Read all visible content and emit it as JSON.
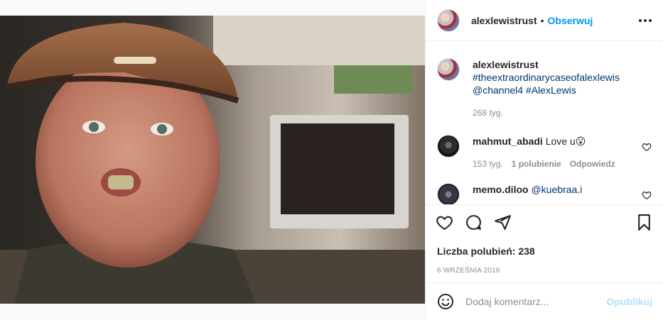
{
  "post": {
    "author": "alexlewistrust",
    "follow_label": "Obserwuj",
    "separator": "•",
    "more_icon": "more-horizontal-icon",
    "photo_alt": "post-photo"
  },
  "caption": {
    "username": "alexlewistrust",
    "hashtag": "#theextraordinarycaseofalexlewis",
    "mention": "@channel4",
    "hashtag2": "#AlexLewis",
    "age": "268 tyg."
  },
  "comments": [
    {
      "username": "mahmut_abadi",
      "text": "Love u",
      "emoji": "😮",
      "age": "153 tyg.",
      "likes": "1 polubienie",
      "reply_label": "Odpowiedz"
    },
    {
      "username": "memo.diloo",
      "mention": "@kuebraa.i"
    }
  ],
  "actions": {
    "like_icon": "heart-icon",
    "comment_icon": "comment-icon",
    "share_icon": "share-icon",
    "save_icon": "bookmark-icon"
  },
  "likes_text": "Liczba polubień: 238",
  "date_text": "6 WRZEŚNIA 2016",
  "comment_box": {
    "emoji_icon": "smiley-icon",
    "placeholder": "Dodaj komentarz...",
    "publish_label": "Opublikuj"
  },
  "colors": {
    "accent": "#0095f6",
    "publish_disabled": "#b2dffc",
    "link": "#00376b",
    "muted": "#8e8e8e",
    "text": "#262626"
  }
}
